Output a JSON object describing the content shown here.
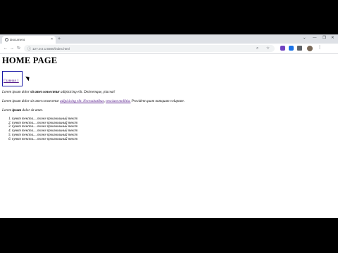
{
  "browser": {
    "tab_title": "Document",
    "tab_close": "×",
    "new_tab": "+",
    "url": "127.0.0.1:5500/index.html",
    "window_controls": [
      "⌄",
      "—",
      "❐",
      "✕"
    ],
    "nav": {
      "back": "←",
      "forward": "→",
      "reload": "↻"
    },
    "colors": {
      "tabstrip": "#dee1e6",
      "ext_purple": "#6f42c1",
      "ext_blue": "#1a73e8"
    }
  },
  "page": {
    "heading": "HOME PAGE",
    "link_box": "Главная 1",
    "p1": {
      "a": "Lorem ipsum dolor ",
      "b": "sit amet consectetur",
      "c": " adipisicing elit. Doloremque, placeat!"
    },
    "p2": {
      "a": "Lorem ipsum dolor sit amet consectetur ",
      "link1": "adipisicing elit. Necessitatibus",
      "b": ", ",
      "link2": "nesciunt mollitia.",
      "c": " Provident quam numquam voluptate."
    },
    "p3": {
      "a": "Lorem ",
      "b": "ipsum",
      "c": " dolor sit amet."
    },
    "list": [
      "пункт текста.... тоже произвольный текст",
      "пункт текста.... тоже произвольный текст",
      "пункт текста.... тоже произвольный текст",
      "пункт текста.... тоже произвольный текст",
      "пункт текста.... тоже произвольный текст",
      "пункт текста.... тоже произвольный текст"
    ]
  }
}
